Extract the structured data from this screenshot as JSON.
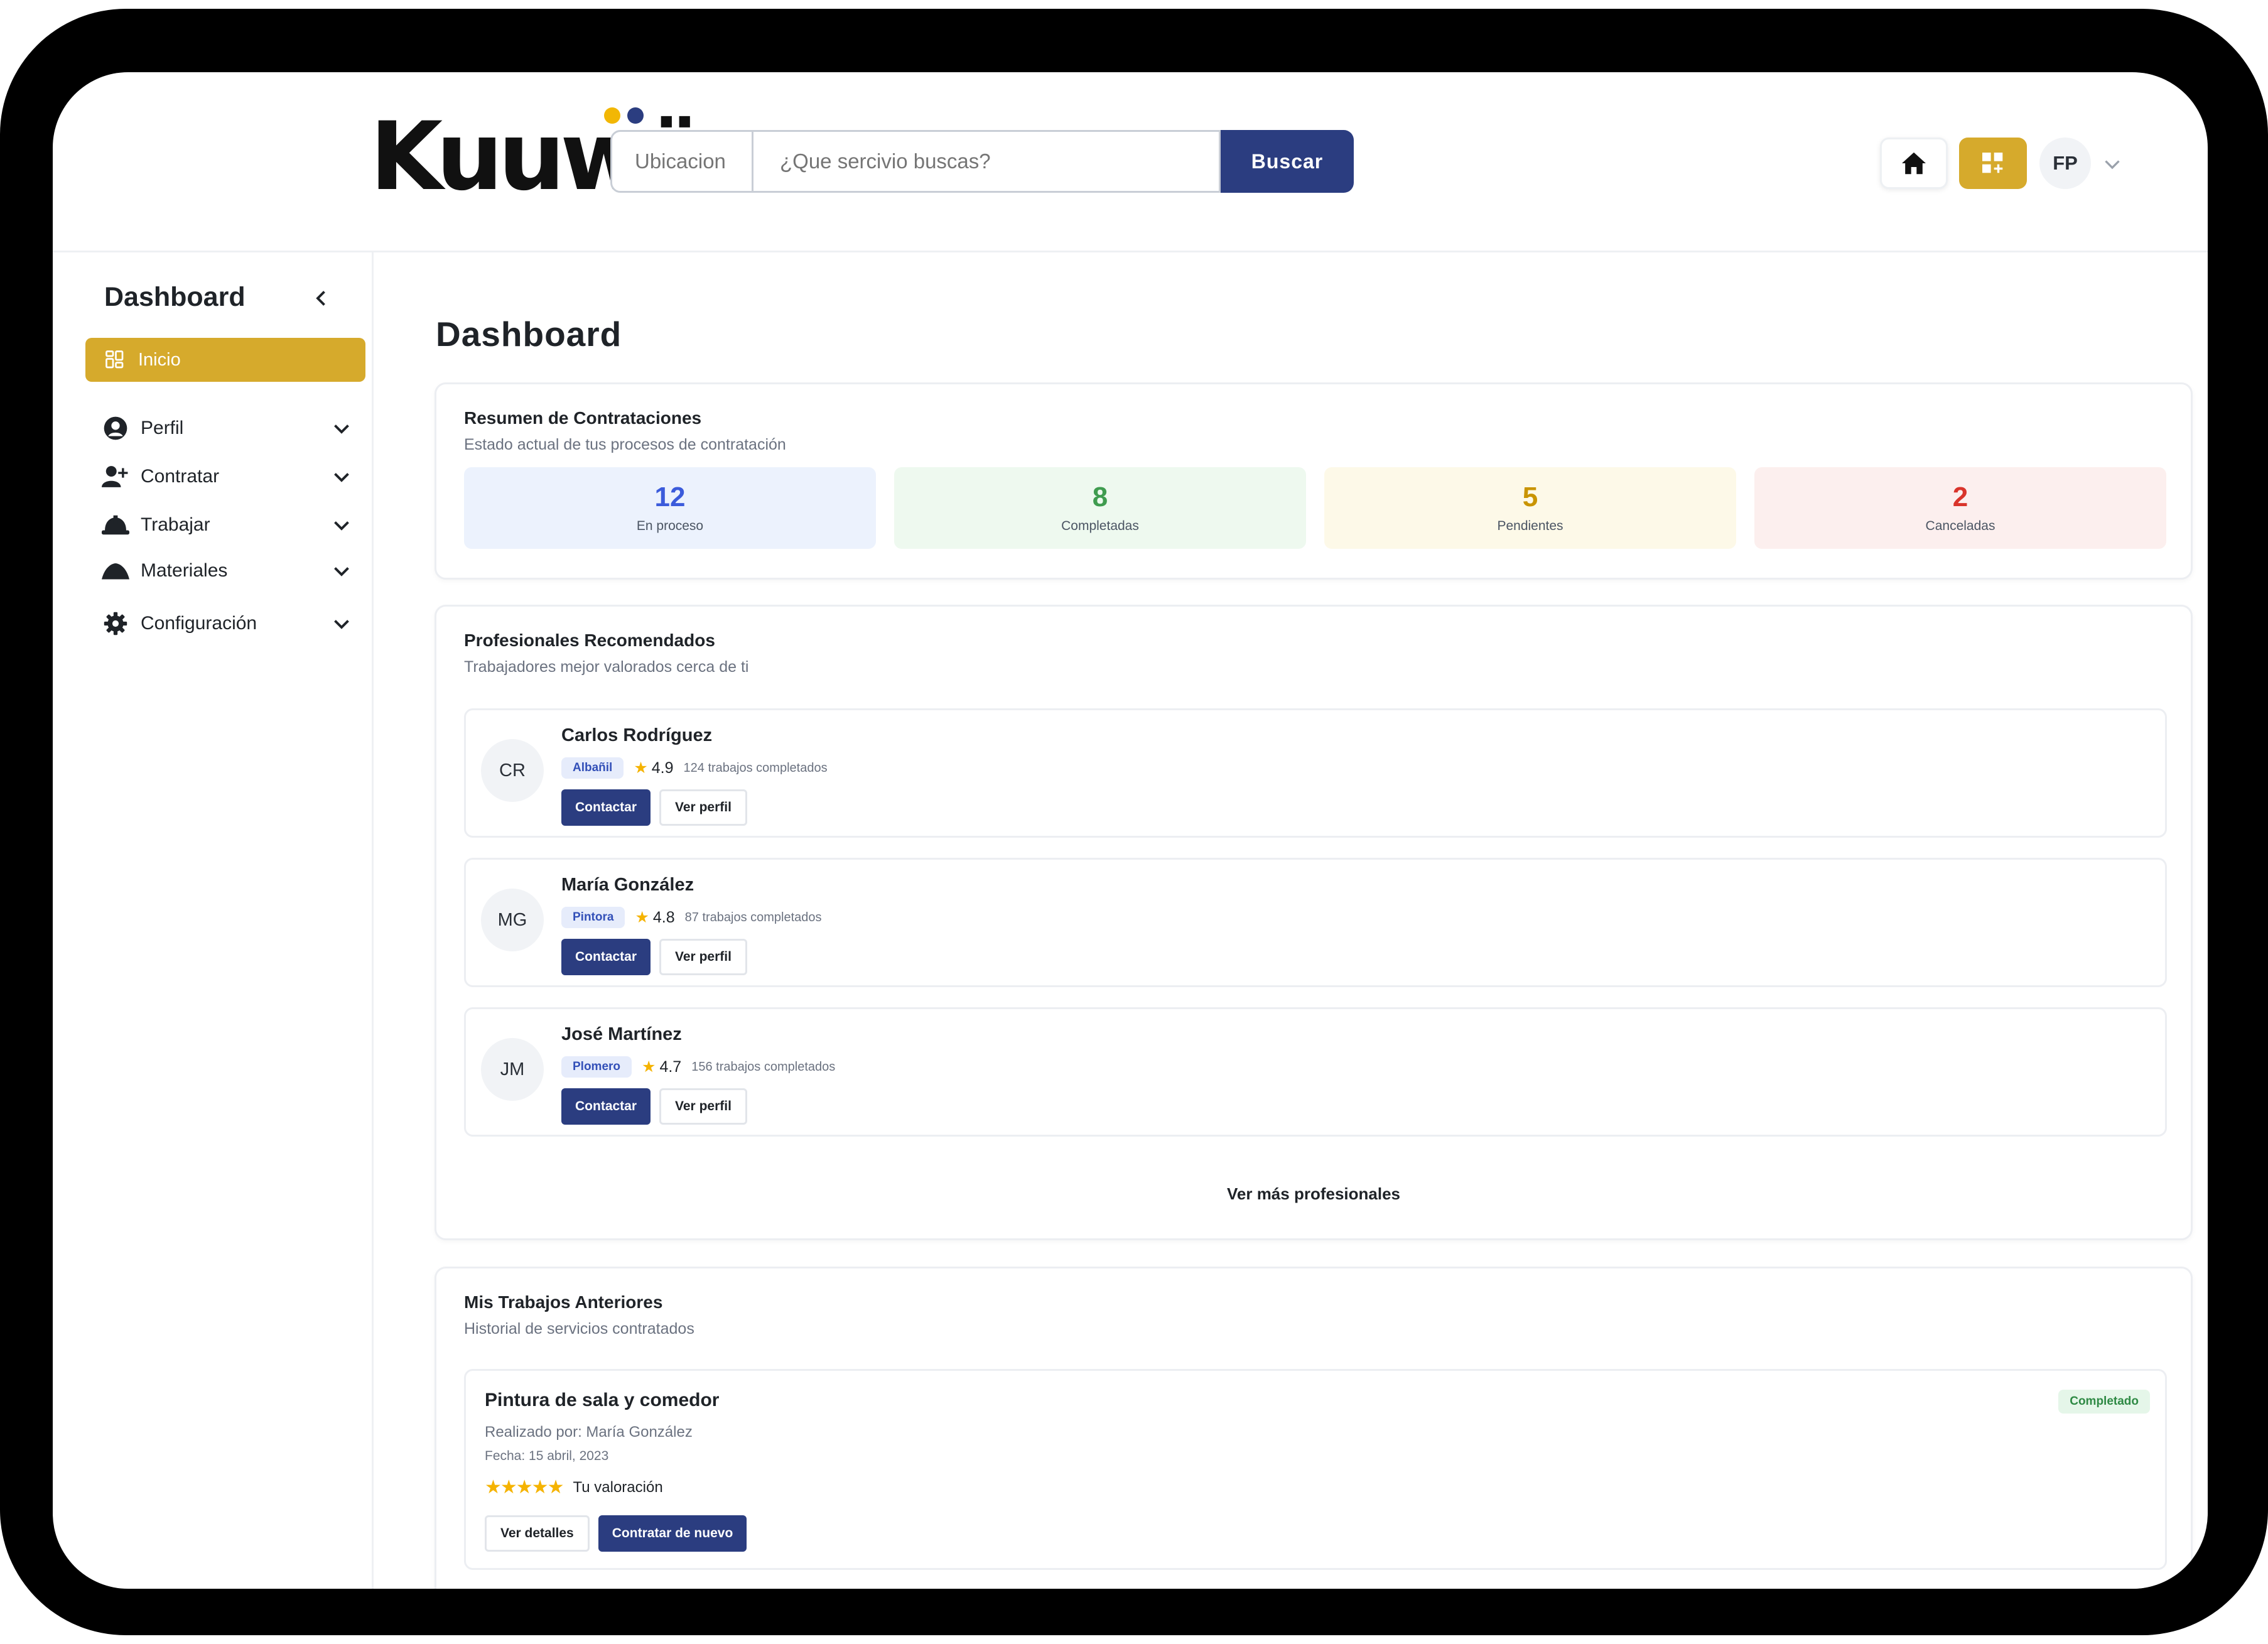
{
  "header": {
    "logo_text": "Kuuwü",
    "colors": {
      "logo_dot_1": "#f2b705",
      "logo_dot_2": "#2b3d80"
    },
    "location_placeholder": "Ubicacion",
    "search_placeholder": "¿Que sercivio buscas?",
    "search_button": "Buscar",
    "user_initials": "FP"
  },
  "sidebar": {
    "title": "Dashboard",
    "active_item": {
      "label": "Inicio",
      "icon": "dashboard-grid-icon"
    },
    "items": [
      {
        "label": "Perfil",
        "icon": "user-circle-icon"
      },
      {
        "label": "Contratar",
        "icon": "user-plus-icon"
      },
      {
        "label": "Trabajar",
        "icon": "hard-hat-icon"
      },
      {
        "label": "Materiales",
        "icon": "mound-icon"
      },
      {
        "label": "Configuración",
        "icon": "gear-icon"
      }
    ]
  },
  "main": {
    "title": "Dashboard",
    "summary": {
      "title": "Resumen de Contrataciones",
      "subtitle": "Estado actual de tus procesos de contratación",
      "stats": [
        {
          "value": "12",
          "label": "En proceso",
          "color": "#3b5bdb",
          "bg": "#ecf2fd"
        },
        {
          "value": "8",
          "label": "Completadas",
          "color": "#3f9c4f",
          "bg": "#eef9ef"
        },
        {
          "value": "5",
          "label": "Pendientes",
          "color": "#c99400",
          "bg": "#fdf9e8"
        },
        {
          "value": "2",
          "label": "Canceladas",
          "color": "#d9342b",
          "bg": "#fcefee"
        }
      ]
    },
    "professionals": {
      "title": "Profesionales Recomendados",
      "subtitle": "Trabajadores mejor valorados cerca de ti",
      "items": [
        {
          "initials": "CR",
          "name": "Carlos Rodríguez",
          "trade": "Albañil",
          "rating": "4.9",
          "jobs": "124 trabajos completados"
        },
        {
          "initials": "MG",
          "name": "María González",
          "trade": "Pintora",
          "rating": "4.8",
          "jobs": "87 trabajos completados"
        },
        {
          "initials": "JM",
          "name": "José Martínez",
          "trade": "Plomero",
          "rating": "4.7",
          "jobs": "156 trabajos completados"
        }
      ],
      "contact_label": "Contactar",
      "profile_label": "Ver perfil",
      "more_label": "Ver más profesionales"
    },
    "past_jobs": {
      "title": "Mis Trabajos Anteriores",
      "subtitle": "Historial de servicios contratados",
      "items": [
        {
          "title": "Pintura de sala y comedor",
          "by": "Realizado por: María González",
          "date": "Fecha: 15 abril, 2023",
          "stars": "★★★★★",
          "rating_label": "Tu valoración",
          "status": "Completado",
          "details_label": "Ver detalles",
          "rehire_label": "Contratar de nuevo"
        }
      ]
    }
  }
}
